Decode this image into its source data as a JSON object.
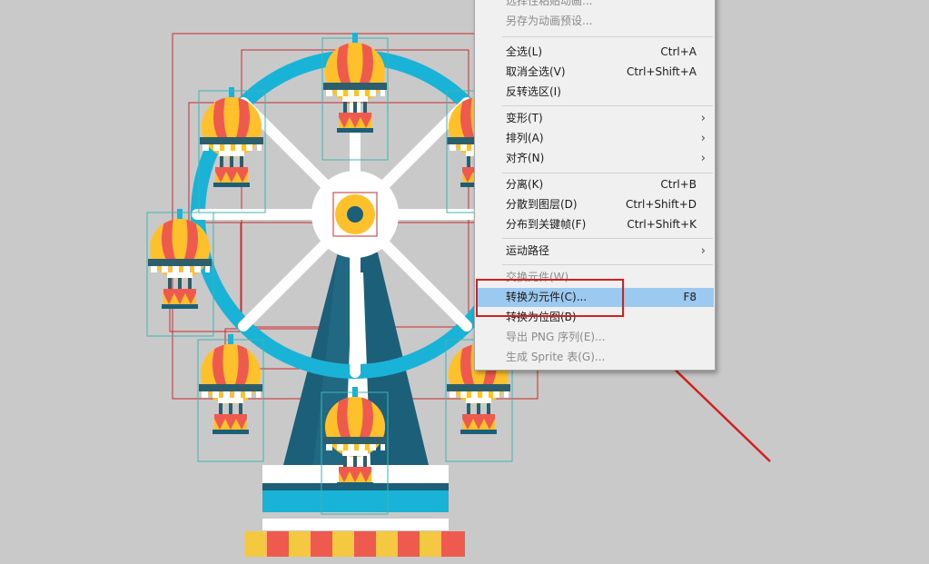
{
  "colors": {
    "background": "#c9c9c9",
    "menu_bg": "#f0f0f0",
    "menu_highlight": "#9bc9f0",
    "annotation_red": "#d41f1f",
    "wheel_blue": "#1ab3d8",
    "wheel_dark": "#1c5f78",
    "balloon_yellow": "#ffc12b",
    "balloon_red": "#ef5a4e",
    "selection_cyan": "#3cb6b4",
    "selection_red": "#cc2a2a"
  },
  "icons": {
    "submenu_arrow": "chevron-right-icon"
  },
  "context_menu": {
    "items": [
      {
        "label": "选择性粘贴动画...",
        "shortcut": "",
        "submenu": false,
        "enabled": false
      },
      {
        "label": "另存为动画预设...",
        "shortcut": "",
        "submenu": false,
        "enabled": false
      },
      {
        "label": "全选(L)",
        "shortcut": "Ctrl+A",
        "submenu": false,
        "enabled": true
      },
      {
        "label": "取消全选(V)",
        "shortcut": "Ctrl+Shift+A",
        "submenu": false,
        "enabled": true
      },
      {
        "label": "反转选区(I)",
        "shortcut": "",
        "submenu": false,
        "enabled": true
      },
      {
        "label": "变形(T)",
        "shortcut": "",
        "submenu": true,
        "enabled": true
      },
      {
        "label": "排列(A)",
        "shortcut": "",
        "submenu": true,
        "enabled": true
      },
      {
        "label": "对齐(N)",
        "shortcut": "",
        "submenu": true,
        "enabled": true
      },
      {
        "label": "分离(K)",
        "shortcut": "Ctrl+B",
        "submenu": false,
        "enabled": true
      },
      {
        "label": "分散到图层(D)",
        "shortcut": "Ctrl+Shift+D",
        "submenu": false,
        "enabled": true
      },
      {
        "label": "分布到关键帧(F)",
        "shortcut": "Ctrl+Shift+K",
        "submenu": false,
        "enabled": true
      },
      {
        "label": "运动路径",
        "shortcut": "",
        "submenu": true,
        "enabled": true
      },
      {
        "label": "交换元件(W)...",
        "shortcut": "",
        "submenu": false,
        "enabled": false
      },
      {
        "label": "转换为元件(C)...",
        "shortcut": "F8",
        "submenu": false,
        "enabled": true,
        "highlighted": true
      },
      {
        "label": "转换为位图(B)",
        "shortcut": "",
        "submenu": false,
        "enabled": true
      },
      {
        "label": "导出 PNG 序列(E)...",
        "shortcut": "",
        "submenu": false,
        "enabled": false
      },
      {
        "label": "生成 Sprite 表(G)...",
        "shortcut": "",
        "submenu": false,
        "enabled": false
      }
    ]
  }
}
